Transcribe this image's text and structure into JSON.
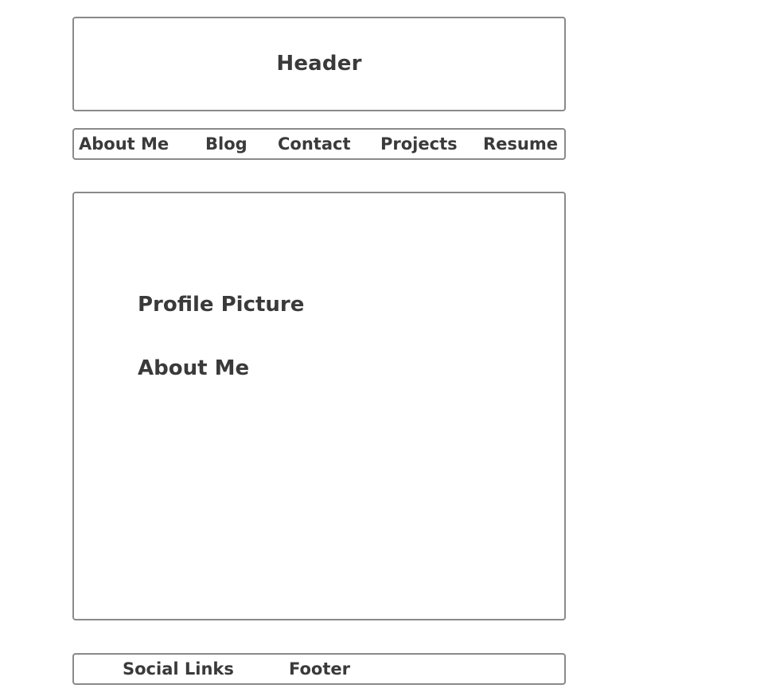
{
  "header": {
    "title": "Header"
  },
  "nav": {
    "items": [
      {
        "label": "About Me"
      },
      {
        "label": "Blog"
      },
      {
        "label": "Contact"
      },
      {
        "label": "Projects"
      },
      {
        "label": "Resume"
      }
    ]
  },
  "main": {
    "profile_picture": "Profile Picture",
    "about_me": "About Me"
  },
  "footer": {
    "social_links": "Social Links",
    "footer_label": "Footer"
  }
}
